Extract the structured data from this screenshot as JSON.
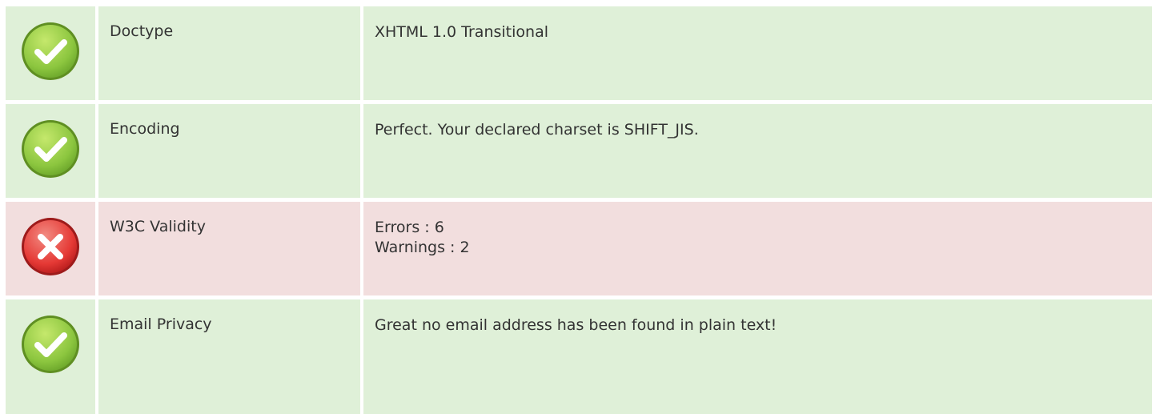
{
  "colors": {
    "pass_background": "#dff0d8",
    "fail_background": "#f2dede",
    "pass_icon": "#8cc63f",
    "fail_icon": "#e53935"
  },
  "rows": [
    {
      "status": "pass",
      "icon": "check-icon",
      "label": "Doctype",
      "value_lines": [
        "XHTML 1.0 Transitional"
      ]
    },
    {
      "status": "pass",
      "icon": "check-icon",
      "label": "Encoding",
      "value_lines": [
        "Perfect. Your declared charset is SHIFT_JIS."
      ]
    },
    {
      "status": "fail",
      "icon": "cross-icon",
      "label": "W3C Validity",
      "value_lines": [
        "Errors : 6",
        "Warnings : 2"
      ]
    },
    {
      "status": "pass",
      "icon": "check-icon",
      "label": "Email Privacy",
      "value_lines": [
        "Great no email address has been found in plain text!"
      ]
    }
  ]
}
